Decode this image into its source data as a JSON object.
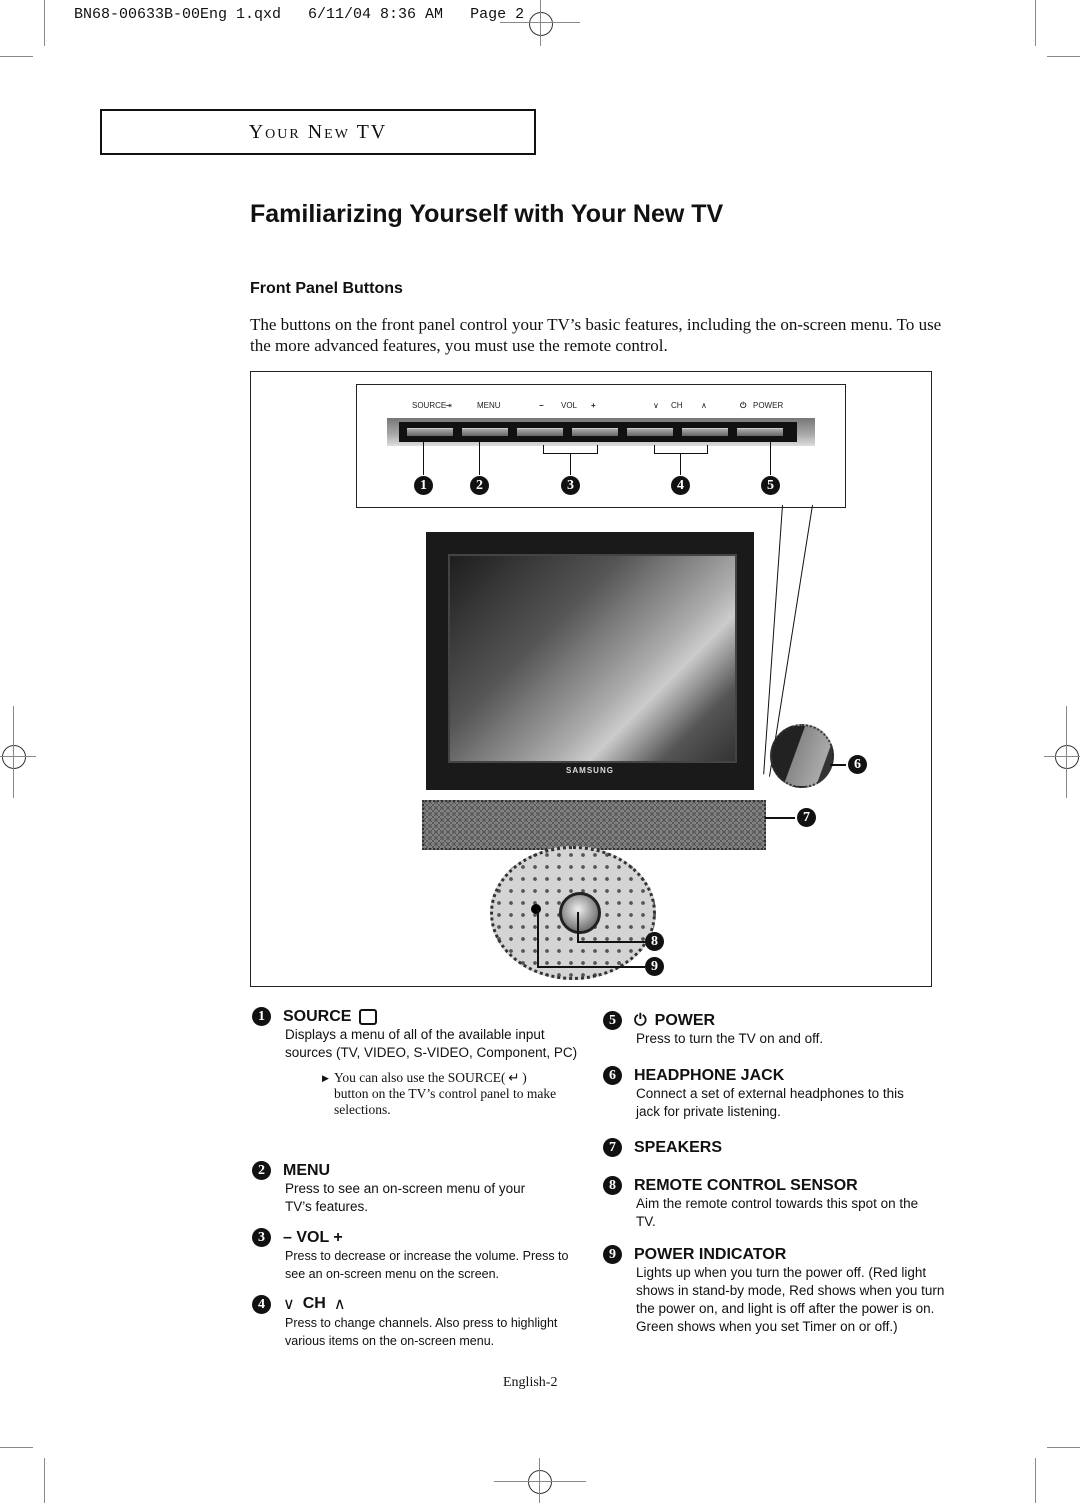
{
  "print_slug": "BN68-00633B-00Eng 1.qxd   6/11/04 8:36 AM   Page 2",
  "section_header": "Your New TV",
  "page_title": "Familiarizing Yourself with Your New TV",
  "subheading": "Front Panel Buttons",
  "intro": "The buttons on the front panel control your TV’s basic features, including the on-screen menu. To use the more advanced features, you must use the remote control.",
  "figure": {
    "panel_labels": [
      "SOURCE",
      "MENU",
      "−",
      "VOL",
      "+",
      "∨",
      "CH",
      "∧",
      "POWER"
    ],
    "callout_numbers": [
      "1",
      "2",
      "3",
      "4",
      "5",
      "6",
      "7",
      "8",
      "9"
    ],
    "brand": "SAMSUNG"
  },
  "items": [
    {
      "num": "1",
      "title": "SOURCE",
      "icon": "source-icon",
      "body": "Displays a menu of all of the available input sources (TV, VIDEO, S-VIDEO, Component, PC)",
      "note": "You can also use the SOURCE( ↵ ) button on the TV’s control panel to make selections."
    },
    {
      "num": "2",
      "title": "MENU",
      "body": "Press to see an on-screen menu of your TV’s features."
    },
    {
      "num": "3",
      "title": "– VOL +",
      "body": "Press to decrease or increase the volume. Press to see an on-screen menu on the screen."
    },
    {
      "num": "4",
      "title": "CH",
      "icon": "chevrons",
      "body": "Press to change channels. Also press to highlight various items on the on-screen menu."
    },
    {
      "num": "5",
      "title": "POWER",
      "icon": "power-icon",
      "body": "Press to turn the TV on and off."
    },
    {
      "num": "6",
      "title": "HEADPHONE JACK",
      "body": "Connect a set of external headphones to this jack for private listening."
    },
    {
      "num": "7",
      "title": "SPEAKERS",
      "body": ""
    },
    {
      "num": "8",
      "title": "REMOTE CONTROL SENSOR",
      "body": "Aim the remote control towards this spot on the TV."
    },
    {
      "num": "9",
      "title": "POWER INDICATOR",
      "body": "Lights up when you turn the power off. (Red light shows in stand-by mode, Red shows when you turn the power on, and light is off after the power is on. Green shows when you set Timer on or off.)"
    }
  ],
  "footer": "English-2"
}
